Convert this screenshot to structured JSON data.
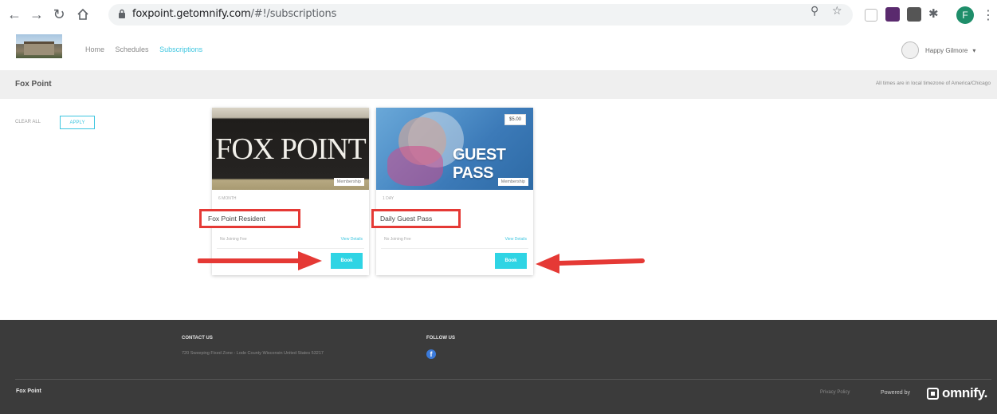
{
  "browser": {
    "url_host": "foxpoint.getomnify.com",
    "url_path": "/#!/subscriptions",
    "profile_initial": "F",
    "extension_colors": [
      "#d9d9d9",
      "#5a2a6e",
      "#555555",
      "#444444"
    ]
  },
  "header": {
    "nav": [
      "Home",
      "Schedules",
      "Subscriptions"
    ],
    "active_nav": "Subscriptions",
    "user_name": "Happy Gilmore"
  },
  "subheader": {
    "title": "Fox Point",
    "timezone_note": "All times are in local timezone of America/Chicago"
  },
  "filters": {
    "clear_all": "CLEAR ALL",
    "apply": "APPLY"
  },
  "cards": [
    {
      "image_text": "FOX POINT",
      "badge": "Membership",
      "duration": "6 MONTH",
      "name": "Fox Point Resident",
      "joining_fee": "No Joining Fee",
      "view_details": "View Details",
      "book": "Book"
    },
    {
      "image_text": "GUEST PASS",
      "price": "$5.00",
      "badge": "Membership",
      "duration": "1 DAY",
      "name": "Daily Guest Pass",
      "joining_fee": "No Joining Fee",
      "view_details": "View Details",
      "book": "Book"
    }
  ],
  "footer": {
    "contact_heading": "CONTACT US",
    "contact_address": "720 Sweeping Fixed Zone - Lode County Wisconsin United States 53217",
    "follow_heading": "FOLLOW US",
    "brand": "Fox Point",
    "privacy": "Privacy Policy",
    "powered_by": "Powered by",
    "omnify_brand": "omnify."
  },
  "colors": {
    "accent": "#3ec6e0",
    "book_button": "#2fd4e4",
    "highlight_red": "#e53935",
    "footer_bg": "#3b3b3b"
  },
  "icons": [
    "back-icon",
    "forward-icon",
    "reload-icon",
    "home-icon",
    "lock-icon",
    "zoom-icon",
    "star-icon",
    "puzzle-icon",
    "kebab-menu-icon",
    "facebook-icon",
    "omnify-logo-icon",
    "arrow-annotation"
  ]
}
